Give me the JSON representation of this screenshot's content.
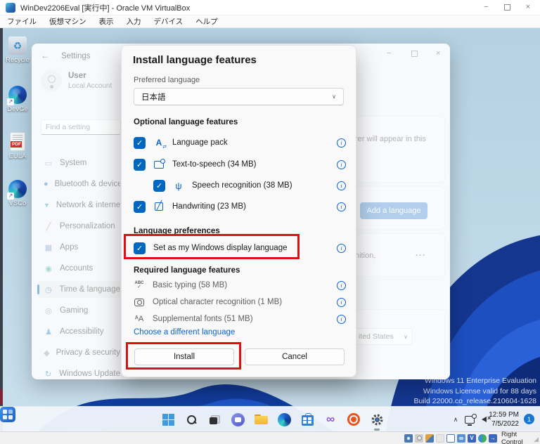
{
  "window": {
    "title": "WinDev2206Eval [実行中] - Oracle VM VirtualBox",
    "menu_items": [
      "ファイル",
      "仮想マシン",
      "表示",
      "入力",
      "デバイス",
      "ヘルプ"
    ],
    "status_bar": {
      "host_key_label": "Right Control"
    }
  },
  "desktop": {
    "icons": [
      {
        "label": "Recycle",
        "icon": "recycle-bin-icon"
      },
      {
        "label": "DevGe",
        "icon": "edge-shortcut-icon"
      },
      {
        "label": "EULA",
        "icon": "pdf-document-icon"
      },
      {
        "label": "VSCo",
        "icon": "vscode-shortcut-icon"
      }
    ],
    "watermark_lines": [
      "Windows 11 Enterprise Evaluation",
      "Windows License valid for 88 days",
      "Build 22000.co_release.210604-1628"
    ]
  },
  "settings_window": {
    "title": "Settings",
    "user": {
      "name": "User",
      "type": "Local Account"
    },
    "search_placeholder": "Find a setting",
    "nav_items": [
      {
        "label": "System",
        "icon": "system-icon"
      },
      {
        "label": "Bluetooth & devices",
        "icon": "bluetooth-icon"
      },
      {
        "label": "Network & internet",
        "icon": "network-icon"
      },
      {
        "label": "Personalization",
        "icon": "personalization-icon"
      },
      {
        "label": "Apps",
        "icon": "apps-icon"
      },
      {
        "label": "Accounts",
        "icon": "accounts-icon"
      },
      {
        "label": "Time & language",
        "icon": "time-language-icon",
        "selected": true
      },
      {
        "label": "Gaming",
        "icon": "gaming-icon"
      },
      {
        "label": "Accessibility",
        "icon": "accessibility-icon"
      },
      {
        "label": "Privacy & security",
        "icon": "privacy-icon"
      },
      {
        "label": "Windows Update",
        "icon": "windows-update-icon"
      }
    ],
    "content": {
      "heading_visible_fragment": "n",
      "card1_visible_fragment": "rer will appear in this",
      "add_language_button": "Add a language",
      "language_row_visible_fragment": "nition,",
      "more_options": "...",
      "region_dropdown_visible_fragment": "ited States"
    }
  },
  "dialog": {
    "title": "Install language features",
    "preferred_language_label": "Preferred language",
    "preferred_language_value": "日本語",
    "optional_header": "Optional language features",
    "optional_features": [
      {
        "label": "Language pack",
        "checked": true,
        "icon": "language-pack-icon"
      },
      {
        "label": "Text-to-speech (34 MB)",
        "checked": true,
        "icon": "text-to-speech-icon"
      },
      {
        "label": "Speech recognition (38 MB)",
        "checked": true,
        "icon": "microphone-icon",
        "indented": true
      },
      {
        "label": "Handwriting (23 MB)",
        "checked": true,
        "icon": "handwriting-icon"
      }
    ],
    "preferences_header": "Language preferences",
    "display_language_option": {
      "label": "Set as my Windows display language",
      "checked": true
    },
    "required_header": "Required language features",
    "required_features": [
      {
        "label": "Basic typing (58 MB)",
        "icon": "basic-typing-icon"
      },
      {
        "label": "Optical character recognition (1 MB)",
        "icon": "ocr-icon"
      },
      {
        "label": "Supplemental fonts (51 MB)",
        "icon": "supplemental-fonts-icon"
      }
    ],
    "different_language_link": "Choose a different language",
    "install_button": "Install",
    "cancel_button": "Cancel"
  },
  "taskbar": {
    "clock": {
      "time": "12:59 PM",
      "date": "7/5/2022"
    },
    "notification_badge": "1"
  },
  "colors": {
    "accent": "#0067c0",
    "annotation": "#e01010",
    "checkbox": "#0067c0"
  }
}
